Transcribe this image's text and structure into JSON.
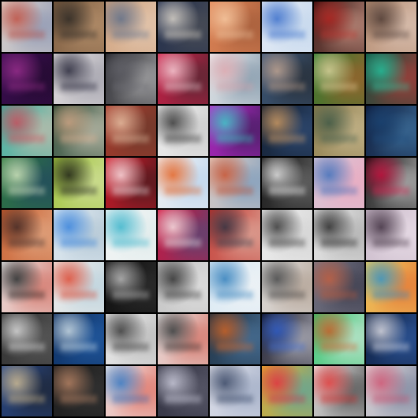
{
  "grid": {
    "rows": 8,
    "columns": 8,
    "background": "#000000",
    "description_note": "",
    "tiles": [
      {
        "colors": [
          "#e6ddd2",
          "#b8453a",
          "#6f7fa8"
        ]
      },
      {
        "colors": [
          "#7a5a3e",
          "#2d2a26",
          "#c7a07a"
        ]
      },
      {
        "colors": [
          "#cfa07b",
          "#5a6f8e",
          "#e9d4c1"
        ]
      },
      {
        "colors": [
          "#1d2a4a",
          "#e8e0d2",
          "#5b5b5b"
        ]
      },
      {
        "colors": [
          "#e78a5a",
          "#f2c9a3",
          "#8b4c2f"
        ]
      },
      {
        "colors": [
          "#e9eef6",
          "#2f67c8",
          "#b7cfe9"
        ]
      },
      {
        "colors": [
          "#2a0b0a",
          "#c22f2a",
          "#f0b8a4"
        ]
      },
      {
        "colors": [
          "#b48a6e",
          "#4b3a35",
          "#e6d3c8"
        ]
      },
      {
        "colors": [
          "#3b0d52",
          "#9a2f8c",
          "#1b0a24"
        ]
      },
      {
        "colors": [
          "#eae6e6",
          "#1a1a2e",
          "#8b8b99"
        ]
      },
      {
        "colors": [
          "#1c1c22",
          "#6b6b72",
          "#d7d7d7"
        ]
      },
      {
        "colors": [
          "#d51f4a",
          "#f0d5da",
          "#2a2a2a"
        ]
      },
      {
        "colors": [
          "#f2f2f2",
          "#d6a0a8",
          "#5e7b93"
        ]
      },
      {
        "colors": [
          "#3e5a7d",
          "#c6a58e",
          "#1f1f1f"
        ]
      },
      {
        "colors": [
          "#2a7a2e",
          "#e8d4a0",
          "#c25a2d"
        ]
      },
      {
        "colors": [
          "#0e4a3a",
          "#2ec4a0",
          "#d83a3a"
        ]
      },
      {
        "colors": [
          "#2fb0a0",
          "#d84a5a",
          "#f0c0b0"
        ]
      },
      {
        "colors": [
          "#1a3e2a",
          "#e0b090",
          "#f3e6d6"
        ]
      },
      {
        "colors": [
          "#a83a2c",
          "#e6c6a8",
          "#5a3a2c"
        ]
      },
      {
        "colors": [
          "#f4f4f4",
          "#2a2a2a",
          "#bcbcbc"
        ]
      },
      {
        "colors": [
          "#c02ad0",
          "#2fd2c0",
          "#1a1a3a"
        ]
      },
      {
        "colors": [
          "#0f1a2a",
          "#d8a36a",
          "#3a5a8a"
        ]
      },
      {
        "colors": [
          "#8a7a4a",
          "#3e5a4a",
          "#d8c8a0"
        ]
      },
      {
        "colors": [
          "#0a1230",
          "#1e4a7a",
          "#4f8fc0"
        ]
      },
      {
        "colors": [
          "#2f7a3e",
          "#d8e6c6",
          "#1e3a6a"
        ]
      },
      {
        "colors": [
          "#9ec23a",
          "#1a1a1a",
          "#e0e8b8"
        ]
      },
      {
        "colors": [
          "#d81a2a",
          "#f4e8ea",
          "#1a1a1a"
        ]
      },
      {
        "colors": [
          "#f6f6f6",
          "#e05a1a",
          "#a8c8e8"
        ]
      },
      {
        "colors": [
          "#e8d4c8",
          "#c04a2a",
          "#5a8ab8"
        ]
      },
      {
        "colors": [
          "#0a0a0a",
          "#f6f6f6",
          "#8a8a8a"
        ]
      },
      {
        "colors": [
          "#d8c8d8",
          "#3a6ab8",
          "#f0a0b8"
        ]
      },
      {
        "colors": [
          "#060606",
          "#d81a4a",
          "#f0f0f0"
        ]
      },
      {
        "colors": [
          "#c85a2a",
          "#3a2a2a",
          "#e8c0a0"
        ]
      },
      {
        "colors": [
          "#e8f0f6",
          "#2a7ad8",
          "#a0b8c8"
        ]
      },
      {
        "colors": [
          "#f6f6f6",
          "#2fb0c8",
          "#d8e8e8"
        ]
      },
      {
        "colors": [
          "#d8103a",
          "#f0f0f0",
          "#2a5a8a"
        ]
      },
      {
        "colors": [
          "#c0302a",
          "#2a3a4a",
          "#e8d0c0"
        ]
      },
      {
        "colors": [
          "#f2f2f2",
          "#2a2a2a",
          "#c8c8c8"
        ]
      },
      {
        "colors": [
          "#f0f0f0",
          "#1a1a1a",
          "#9a9a9a"
        ]
      },
      {
        "colors": [
          "#c8b8c8",
          "#3a2a3a",
          "#f2e8f0"
        ]
      },
      {
        "colors": [
          "#f2f2f2",
          "#1a1a1a",
          "#c84a3a"
        ]
      },
      {
        "colors": [
          "#f4f0ec",
          "#d8402a",
          "#a8c8d8"
        ]
      },
      {
        "colors": [
          "#0a0a0a",
          "#c8c8c8",
          "#3a3a3a"
        ]
      },
      {
        "colors": [
          "#c0c0c0",
          "#2a2a2a",
          "#e8e8e8"
        ]
      },
      {
        "colors": [
          "#d8e8f4",
          "#2a7ab8",
          "#f6f6f6"
        ]
      },
      {
        "colors": [
          "#e8e8e8",
          "#3a3a3a",
          "#a08a78"
        ]
      },
      {
        "colors": [
          "#7a7a8a",
          "#c05a3a",
          "#2a2a3a"
        ]
      },
      {
        "colors": [
          "#f0d060",
          "#2a8ac8",
          "#e05a2a"
        ]
      },
      {
        "colors": [
          "#2a2a2a",
          "#e8e8e8",
          "#6a6a6a"
        ]
      },
      {
        "colors": [
          "#0a2a5a",
          "#d8e8f0",
          "#2a6ab8"
        ]
      },
      {
        "colors": [
          "#f2f2f2",
          "#2a2a2a",
          "#a8a8a8"
        ]
      },
      {
        "colors": [
          "#f0f0f0",
          "#2a2a2a",
          "#c84a3a"
        ]
      },
      {
        "colors": [
          "#1a2a3a",
          "#d86a2a",
          "#5a8ab8"
        ]
      },
      {
        "colors": [
          "#0a0a1a",
          "#3a6ad8",
          "#e8e8f0"
        ]
      },
      {
        "colors": [
          "#2fc06a",
          "#d85a2a",
          "#f2f2f2"
        ]
      },
      {
        "colors": [
          "#0a1a3a",
          "#e8e8f0",
          "#3a6ab8"
        ]
      },
      {
        "colors": [
          "#2a4a8a",
          "#d8c090",
          "#1a1a1a"
        ]
      },
      {
        "colors": [
          "#1a1a1a",
          "#c08a6a",
          "#3a3a3a"
        ]
      },
      {
        "colors": [
          "#f2f2f2",
          "#2a6ab8",
          "#d84a3a"
        ]
      },
      {
        "colors": [
          "#2a2a3a",
          "#d8d8e8",
          "#6a6a7a"
        ]
      },
      {
        "colors": [
          "#e8e8f0",
          "#2a3a5a",
          "#8a9ab8"
        ]
      },
      {
        "colors": [
          "#e8b02a",
          "#d82a4a",
          "#2fa0c0"
        ]
      },
      {
        "colors": [
          "#f2f2f2",
          "#d82a2a",
          "#1a1a1a"
        ]
      },
      {
        "colors": [
          "#e8e0e0",
          "#c84a6a",
          "#5a6a8a"
        ]
      }
    ]
  }
}
